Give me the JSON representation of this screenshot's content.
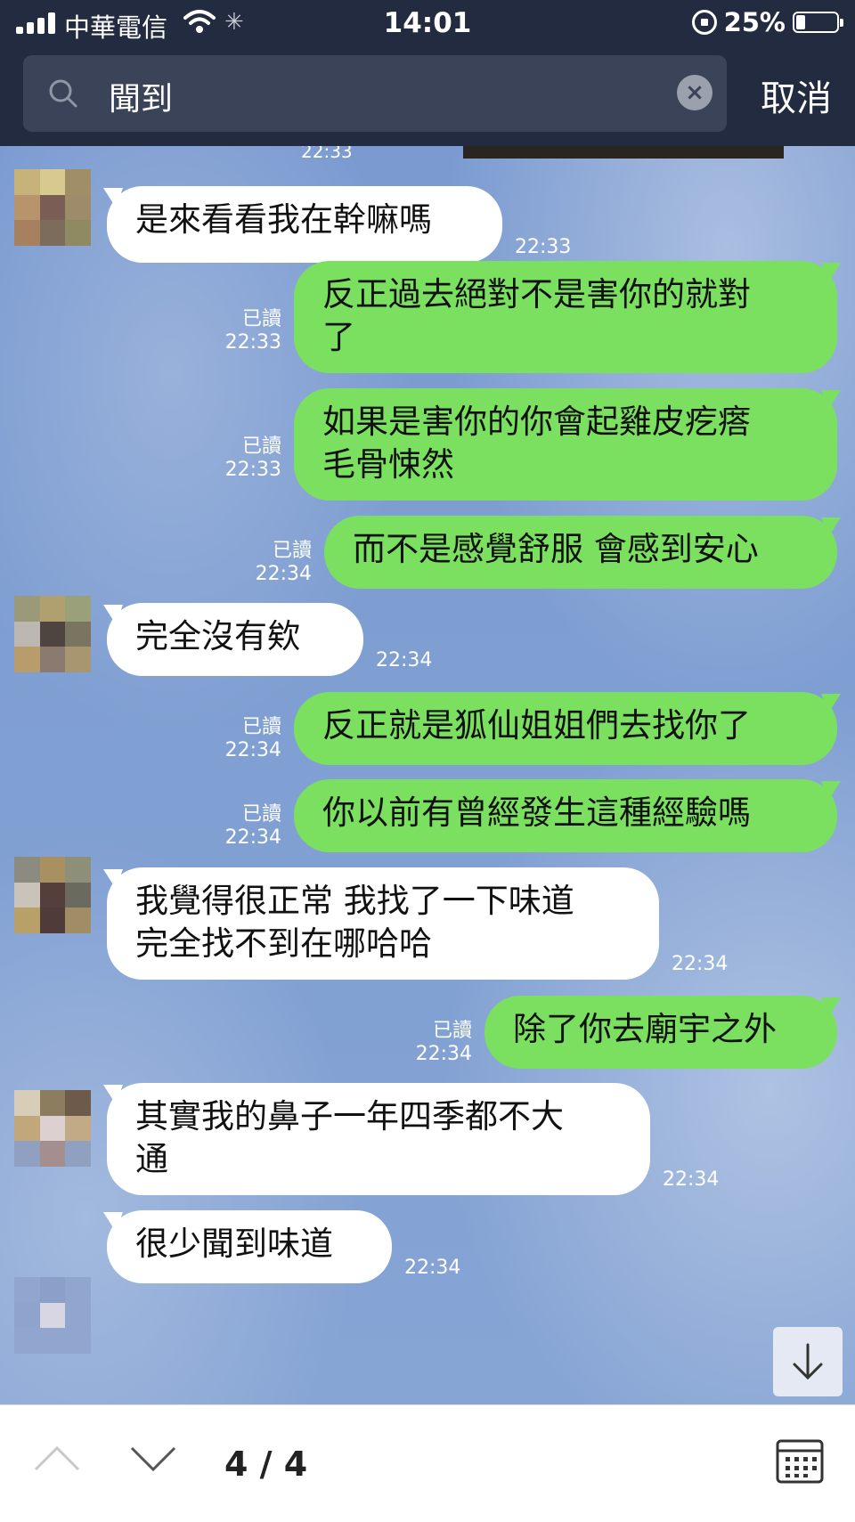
{
  "status_bar": {
    "carrier": "中華電信",
    "time": "14:01",
    "battery": "25%"
  },
  "search": {
    "query": "聞到",
    "cancel_label": "取消"
  },
  "chat": {
    "top_partial_time": "22:33",
    "messages": [
      {
        "side": "in",
        "lines": [
          "是來看看我在幹嘛嗎"
        ],
        "time": "22:33"
      },
      {
        "side": "out",
        "lines": [
          "反正過去絕對不是害你的就對",
          "了"
        ],
        "read": "已讀",
        "time": "22:33"
      },
      {
        "side": "out",
        "lines": [
          "如果是害你的你會起雞皮疙瘩",
          "毛骨悚然"
        ],
        "read": "已讀",
        "time": "22:33"
      },
      {
        "side": "out",
        "lines": [
          "而不是感覺舒服 會感到安心"
        ],
        "read": "已讀",
        "time": "22:34"
      },
      {
        "side": "in",
        "lines": [
          "完全沒有欸"
        ],
        "time": "22:34"
      },
      {
        "side": "out",
        "lines": [
          "反正就是狐仙姐姐們去找你了"
        ],
        "read": "已讀",
        "time": "22:34"
      },
      {
        "side": "out",
        "lines": [
          "你以前有曾經發生這種經驗嗎"
        ],
        "read": "已讀",
        "time": "22:34"
      },
      {
        "side": "in",
        "lines": [
          "我覺得很正常 我找了一下味道",
          "完全找不到在哪哈哈"
        ],
        "time": "22:34"
      },
      {
        "side": "out",
        "lines": [
          "除了你去廟宇之外"
        ],
        "read": "已讀",
        "time": "22:34"
      },
      {
        "side": "in",
        "lines": [
          "其實我的鼻子一年四季都不大",
          "通"
        ],
        "time": "22:34"
      },
      {
        "side": "in",
        "lines": [
          "很少聞到味道"
        ],
        "time": "22:34"
      }
    ]
  },
  "footer": {
    "result_counter": "4 / 4"
  },
  "colors": {
    "header_bg": "#222b3f",
    "bubble_out": "#7be05f",
    "bubble_in": "#ffffff"
  }
}
